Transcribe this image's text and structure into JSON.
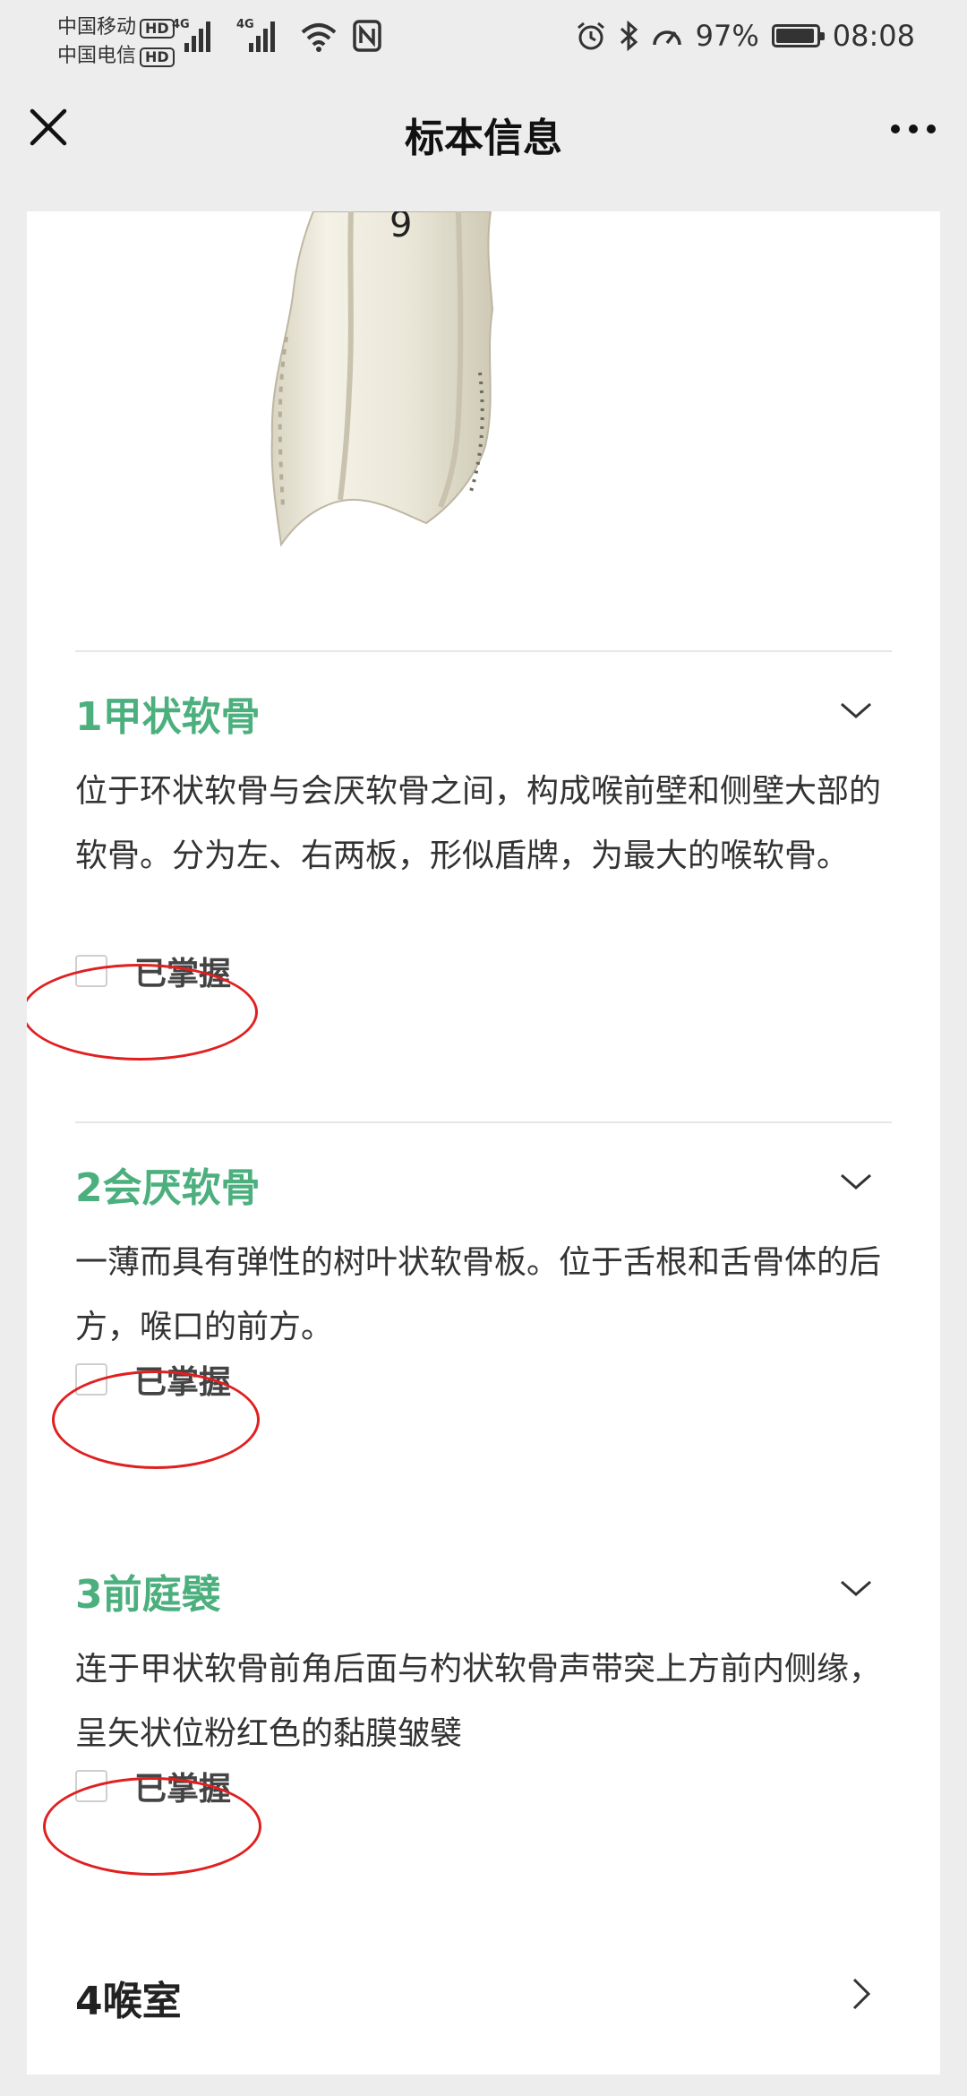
{
  "status_bar": {
    "carrier1": "中国移动",
    "carrier2": "中国电信",
    "hd_badge": "HD",
    "network1": "4G",
    "network2": "4G",
    "battery_percent": "97%",
    "battery_level": 0.97,
    "time": "08:08"
  },
  "header": {
    "title": "标本信息"
  },
  "sections": [
    {
      "title": "1甲状软骨",
      "description": "位于环状软骨与会厌软骨之间，构成喉前壁和侧壁大部的软骨。分为左、右两板，形似盾牌，为最大的喉软骨。",
      "checkbox_label": "已掌握",
      "checked": false
    },
    {
      "title": "2会厌软骨",
      "description": "一薄而具有弹性的树叶状软骨板。位于舌根和舌骨体的后方，喉口的前方。",
      "checkbox_label": "已掌握",
      "checked": false
    },
    {
      "title": "3前庭襞",
      "description": "连于甲状软骨前角后面与杓状软骨声带突上方前内侧缘，呈矢状位粉红色的黏膜皱襞",
      "checkbox_label": "已掌握",
      "checked": false
    },
    {
      "title": "4喉室"
    }
  ],
  "specimen_label": "9",
  "colors": {
    "accent_green": "#4caf7e",
    "annotation_red": "#e02020",
    "background": "#ededed"
  }
}
